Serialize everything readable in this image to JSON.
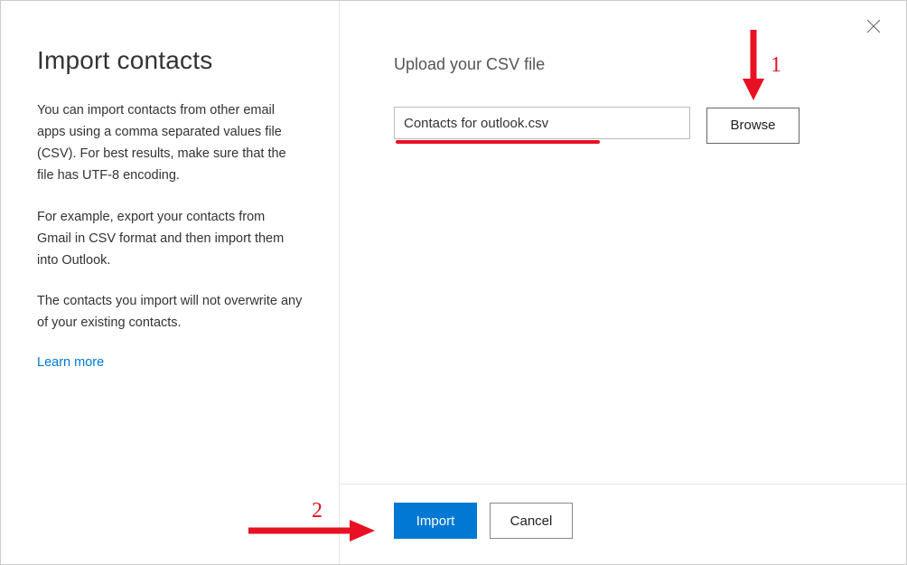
{
  "sidebar": {
    "title": "Import contacts",
    "paragraphs": [
      "You can import contacts from other email apps using a comma separated values file (CSV). For best results, make sure that the file has UTF-8 encoding.",
      "For example, export your contacts from Gmail in CSV format and then import them into Outlook.",
      "The contacts you import will not overwrite any of your existing contacts."
    ],
    "learn_more_label": "Learn more"
  },
  "main": {
    "upload_label": "Upload your CSV file",
    "selected_file": "Contacts for outlook.csv",
    "browse_label": "Browse"
  },
  "footer": {
    "import_label": "Import",
    "cancel_label": "Cancel"
  },
  "annotations": {
    "step1": "1",
    "step2": "2"
  }
}
